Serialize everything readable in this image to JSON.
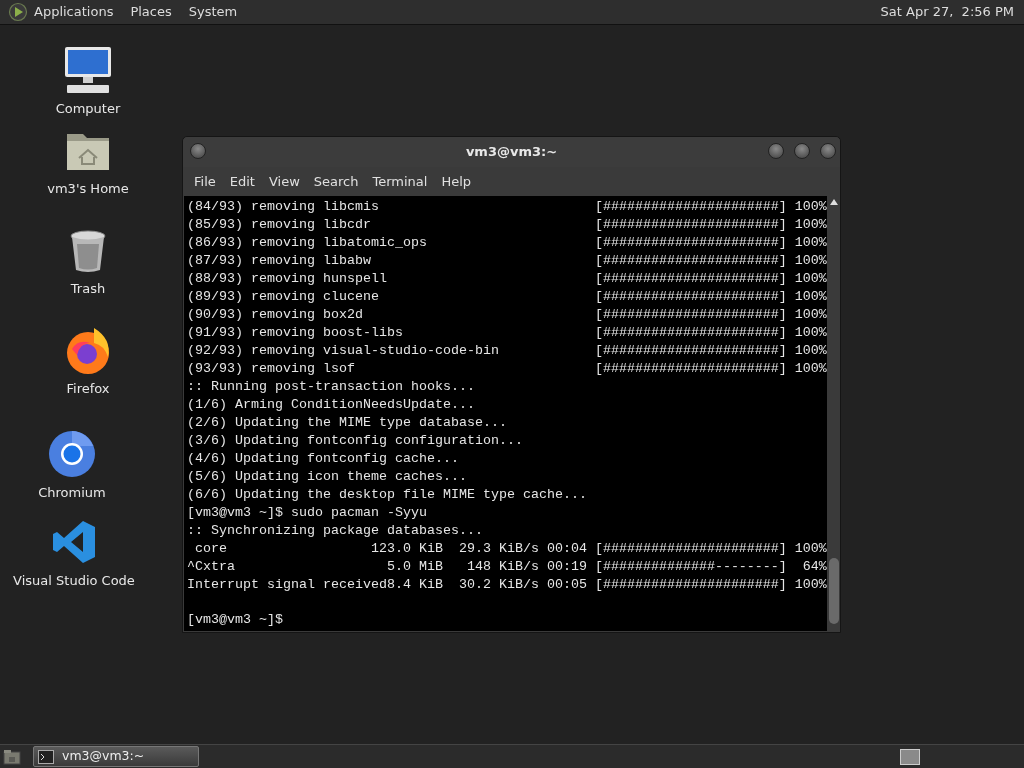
{
  "top_panel": {
    "menus": [
      "Applications",
      "Places",
      "System"
    ],
    "clock": "Sat Apr 27,  2:56 PM"
  },
  "desktop_icons": [
    {
      "label": "Computer",
      "kind": "computer"
    },
    {
      "label": "vm3's Home",
      "kind": "home"
    },
    {
      "label": "Trash",
      "kind": "trash"
    },
    {
      "label": "Firefox",
      "kind": "firefox"
    },
    {
      "label": "Chromium",
      "kind": "chromium"
    },
    {
      "label": "Visual Studio Code",
      "kind": "vscode"
    }
  ],
  "terminal": {
    "title": "vm3@vm3:~",
    "menus": [
      "File",
      "Edit",
      "View",
      "Search",
      "Terminal",
      "Help"
    ],
    "lines": [
      {
        "text": "(84/93) removing libcmis",
        "progress": "[######################] 100%"
      },
      {
        "text": "(85/93) removing libcdr",
        "progress": "[######################] 100%"
      },
      {
        "text": "(86/93) removing libatomic_ops",
        "progress": "[######################] 100%"
      },
      {
        "text": "(87/93) removing libabw",
        "progress": "[######################] 100%"
      },
      {
        "text": "(88/93) removing hunspell",
        "progress": "[######################] 100%"
      },
      {
        "text": "(89/93) removing clucene",
        "progress": "[######################] 100%"
      },
      {
        "text": "(90/93) removing box2d",
        "progress": "[######################] 100%"
      },
      {
        "text": "(91/93) removing boost-libs",
        "progress": "[######################] 100%"
      },
      {
        "text": "(92/93) removing visual-studio-code-bin",
        "progress": "[######################] 100%"
      },
      {
        "text": "(93/93) removing lsof",
        "progress": "[######################] 100%"
      },
      {
        "text": ":: Running post-transaction hooks..."
      },
      {
        "text": "(1/6) Arming ConditionNeedsUpdate..."
      },
      {
        "text": "(2/6) Updating the MIME type database..."
      },
      {
        "text": "(3/6) Updating fontconfig configuration..."
      },
      {
        "text": "(4/6) Updating fontconfig cache..."
      },
      {
        "text": "(5/6) Updating icon theme caches..."
      },
      {
        "text": "(6/6) Updating the desktop file MIME type cache..."
      },
      {
        "text": "[vm3@vm3 ~]$ sudo pacman -Syyu"
      },
      {
        "text": ":: Synchronizing package databases..."
      },
      {
        "text": " core                  123.0 KiB  29.3 KiB/s 00:04",
        "progress": "[######################] 100%"
      },
      {
        "text": "^Cxtra                   5.0 MiB   148 KiB/s 00:19",
        "progress": "[##############--------]  64%"
      },
      {
        "text": "Interrupt signal received8.4 KiB  30.2 KiB/s 00:05",
        "progress": "[######################] 100%"
      },
      {
        "text": "[vm3@vm3 ~]$"
      }
    ]
  },
  "taskbar": {
    "tasks": [
      {
        "label": "vm3@vm3:~",
        "selected": true
      }
    ]
  }
}
